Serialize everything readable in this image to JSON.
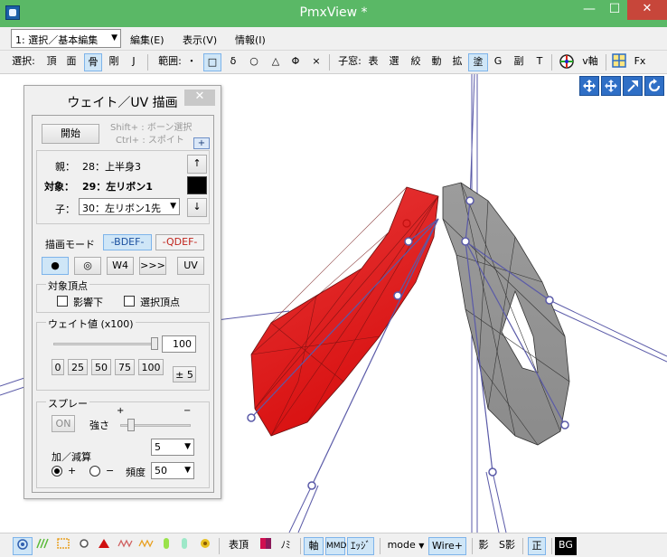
{
  "window": {
    "title": "PmxView *",
    "min": "—",
    "max": "☐",
    "close": "✕"
  },
  "menubar": {
    "mode_select": "1: 選択／基本編集",
    "items": [
      "編集(E)",
      "表示(V)",
      "情報(I)"
    ]
  },
  "toolbar": {
    "select_label": "選択:",
    "select_items": [
      "頂",
      "面",
      "骨",
      "剛",
      "J"
    ],
    "range_label": "範囲:",
    "range_items": [
      "・",
      "□",
      "δ",
      "○",
      "△",
      "Φ",
      "×"
    ],
    "subwin_label": "子窓:",
    "subwin_items": [
      "表",
      "選",
      "絞",
      "動",
      "拡",
      "塗",
      "G",
      "副",
      "T"
    ],
    "axis_label": "v軸",
    "fx_label": "Fx"
  },
  "panel": {
    "title": "ウェイト／UV 描画",
    "close": "✕",
    "start_button": "開始",
    "hint_shift": "Shift+ : ボーン選択",
    "hint_ctrl": "Ctrl+ : スポイト",
    "plus_button": "+",
    "parent_label": "親：",
    "parent_value": "28：上半身3",
    "up_button": "↑",
    "target_label": "対象：",
    "target_value": "29：左リボン1",
    "child_label": "子：",
    "child_value": "30：左リボン1先",
    "down_button": "↓",
    "draw_mode_label": "描画モード",
    "bdef_button": "-BDEF-",
    "qdef_button": "-QDEF-",
    "tool_buttons": [
      "●",
      "◎",
      "W4",
      ">>>",
      "UV"
    ],
    "target_vertex_caption": "対象頂点",
    "influence_label": "影響下",
    "selected_vertex_label": "選択頂点",
    "weight_caption": "ウェイト値 (x100)",
    "weight_value": "100",
    "weight_level": 1.0,
    "preset_buttons": [
      "0",
      "25",
      "50",
      "75",
      "100"
    ],
    "pm5_button": "± 5",
    "spray_caption": "スプレー",
    "spray_on": "ON",
    "strength_label": "強さ",
    "strength_plus": "+",
    "strength_minus": "−",
    "strength_value": "5",
    "addsub_label": "加／減算",
    "add_label": "+",
    "sub_label": "−",
    "freq_label": "頻度",
    "freq_value": "50"
  },
  "statusbar": {
    "vertex_label": "表頂",
    "bone_label": "ﾉﾐ",
    "axis_label": "軸",
    "mmd_label": "MMD",
    "edge_label": "ｴｯｼﾞ",
    "mode_label": "mode",
    "wire_label": "Wire+",
    "shadow_label": "影",
    "sshadow_label": "S影",
    "ortho_label": "正",
    "bg_label": "BG"
  },
  "colors": {
    "titlebar": "#5ab866",
    "accent": "#2f6fc6",
    "weight_red": "#e21b1b",
    "mesh_gray": "#8e8e8e",
    "bone_line": "#5a5aa8"
  }
}
